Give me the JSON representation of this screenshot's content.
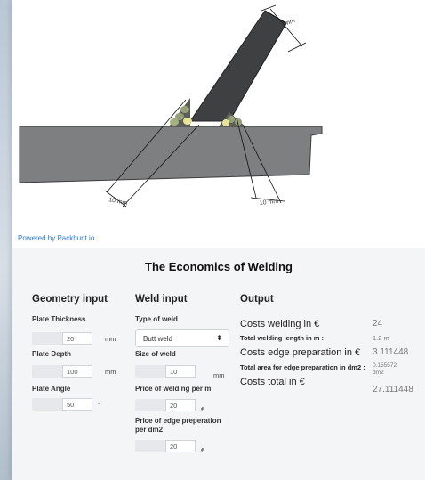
{
  "drawing": {
    "dim_top": "20 mm",
    "dim_left": "10 mm",
    "dim_right": "10 mm"
  },
  "powered_by": "Powered by Packhunt.io",
  "panel_title": "The Economics of Welding",
  "geometry": {
    "heading": "Geometry input",
    "plate_thickness": {
      "label": "Plate Thickness",
      "value": "20",
      "unit": "mm"
    },
    "plate_depth": {
      "label": "Plate Depth",
      "value": "100",
      "unit": "mm"
    },
    "plate_angle": {
      "label": "Plate Angle",
      "value": "50",
      "unit": "°"
    }
  },
  "weld": {
    "heading": "Weld input",
    "type_label": "Type of weld",
    "type_value": "Butt weld",
    "size": {
      "label": "Size of weld",
      "value": "10",
      "unit": "mm"
    },
    "price_weld": {
      "label": "Price of welding per m",
      "value": "20",
      "unit": "€"
    },
    "price_edge": {
      "label": "Price of edge preperation per dm2",
      "value": "20",
      "unit": "€"
    }
  },
  "output": {
    "heading": "Output",
    "rows": [
      {
        "label": "Costs welding in €",
        "value": "24"
      },
      {
        "label": "Total welding length in m :",
        "value": "1.2 m"
      },
      {
        "label": "Costs edge preparation in €",
        "value": "3.111448"
      },
      {
        "label": "Total area for edge preparation in dm2 :",
        "value": "0.155572 dm2"
      },
      {
        "label": "Costs total in €",
        "value": "27.111448"
      }
    ]
  }
}
